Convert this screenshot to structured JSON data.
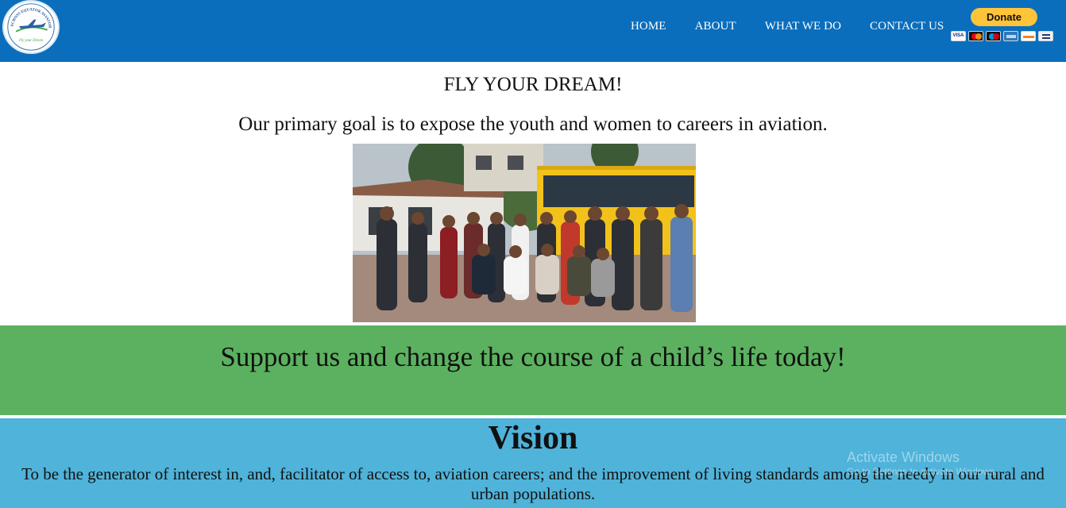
{
  "header": {
    "logo_alt": "Across Equator Aviators Limited logo",
    "logo_ring_text": "ACROSS EQUATOR AVIATORS LIMITED",
    "logo_tagline": "Fly your Dream",
    "nav": [
      {
        "label": "HOME"
      },
      {
        "label": "ABOUT"
      },
      {
        "label": "WHAT WE DO"
      },
      {
        "label": "CONTACT US"
      }
    ],
    "donate": {
      "label": "Donate",
      "cards": [
        "visa",
        "mastercard",
        "maestro",
        "amex",
        "discover",
        "bank"
      ]
    }
  },
  "hero": {
    "title": "FLY YOUR DREAM!",
    "goal": "Our primary goal is to expose the youth and women to careers in aviation.",
    "photo_alt": "Group photo of people standing in front of a yellow school bus"
  },
  "support": {
    "text": "Support us and change the course of a child’s life today!"
  },
  "vision": {
    "title": "Vision",
    "text": "To be the generator of interest in, and, facilitator of access to, aviation careers; and the improvement of living standards among the needy in our rural and urban populations."
  },
  "watermark": {
    "title": "Activate Windows",
    "subtitle": "Go to Settings to activate Windows."
  },
  "colors": {
    "header_bg": "#0a6ebd",
    "support_bg": "#5cb160",
    "vision_bg": "#4fb3da",
    "donate_button": "#ffc439"
  }
}
